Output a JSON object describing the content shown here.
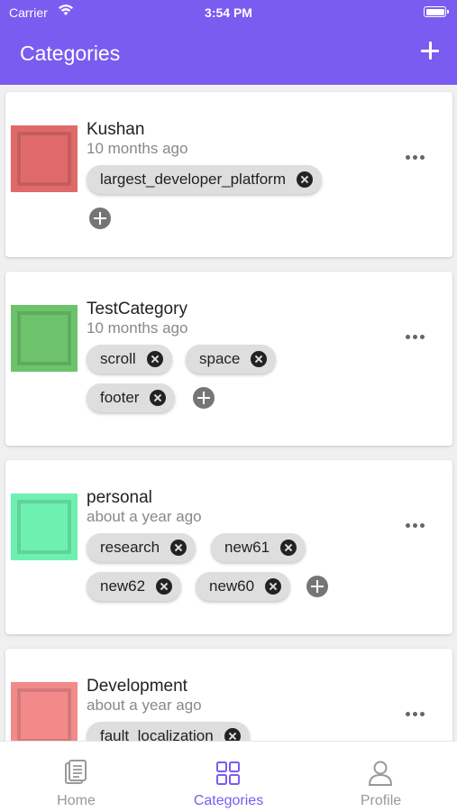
{
  "status_bar": {
    "carrier": "Carrier",
    "time": "3:54 PM"
  },
  "header": {
    "title": "Categories",
    "add_icon": "plus-icon"
  },
  "categories": [
    {
      "name": "Kushan",
      "time": "10 months ago",
      "color": "#e06a6a",
      "tags": [
        "largest_developer_platform"
      ]
    },
    {
      "name": "TestCategory",
      "time": "10 months ago",
      "color": "#6cc36c",
      "tags": [
        "scroll",
        "space",
        "footer"
      ]
    },
    {
      "name": "personal",
      "time": "about a year ago",
      "color": "#6ef0b0",
      "tags": [
        "research",
        "new61",
        "new62",
        "new60"
      ]
    },
    {
      "name": "Development",
      "time": "about a year ago",
      "color": "#f28a8a",
      "tags": [
        "fault_localization"
      ]
    }
  ],
  "bottom_nav": {
    "items": [
      {
        "label": "Home",
        "icon": "document-icon",
        "active": false
      },
      {
        "label": "Categories",
        "icon": "grid-icon",
        "active": true
      },
      {
        "label": "Profile",
        "icon": "person-icon",
        "active": false
      }
    ]
  },
  "colors": {
    "accent": "#7a5cf0",
    "chip_bg": "#dedede"
  }
}
